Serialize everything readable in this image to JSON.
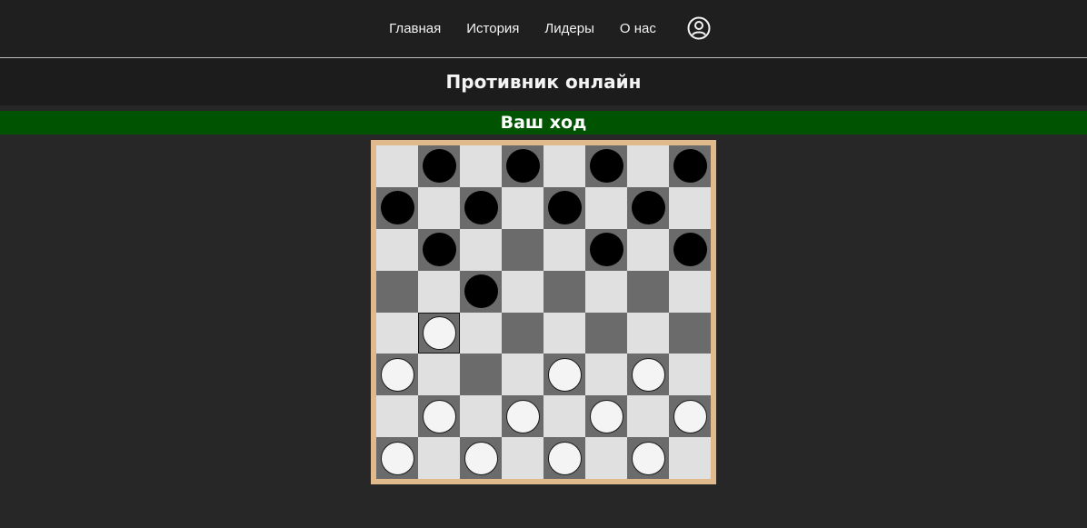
{
  "nav": {
    "links": [
      "Главная",
      "История",
      "Лидеры",
      "О нас"
    ],
    "profile_icon": "user-circle-icon"
  },
  "page": {
    "title": "Противник онлайн",
    "turn_status": "Ваш ход"
  },
  "colors": {
    "nav_bg": "#1f1f1f",
    "page_bg": "#272727",
    "turn_banner": "#005300",
    "board_frame": "#e0b98c",
    "light_square": "#e0e0e0",
    "dark_square": "#6b6b6b"
  },
  "board": {
    "size": 8,
    "selected": [
      4,
      1
    ],
    "rows": [
      [
        ".",
        "b",
        ".",
        "b",
        ".",
        "b",
        ".",
        "b"
      ],
      [
        "b",
        ".",
        "b",
        ".",
        "b",
        ".",
        "b",
        "."
      ],
      [
        ".",
        "b",
        ".",
        ".",
        ".",
        "b",
        ".",
        "b"
      ],
      [
        ".",
        ".",
        "b",
        ".",
        ".",
        ".",
        ".",
        "."
      ],
      [
        ".",
        "w",
        ".",
        ".",
        ".",
        ".",
        ".",
        "."
      ],
      [
        "w",
        ".",
        ".",
        ".",
        "w",
        ".",
        "w",
        "."
      ],
      [
        ".",
        "w",
        ".",
        "w",
        ".",
        "w",
        ".",
        "w"
      ],
      [
        "w",
        ".",
        "w",
        ".",
        "w",
        ".",
        "w",
        "."
      ]
    ]
  }
}
